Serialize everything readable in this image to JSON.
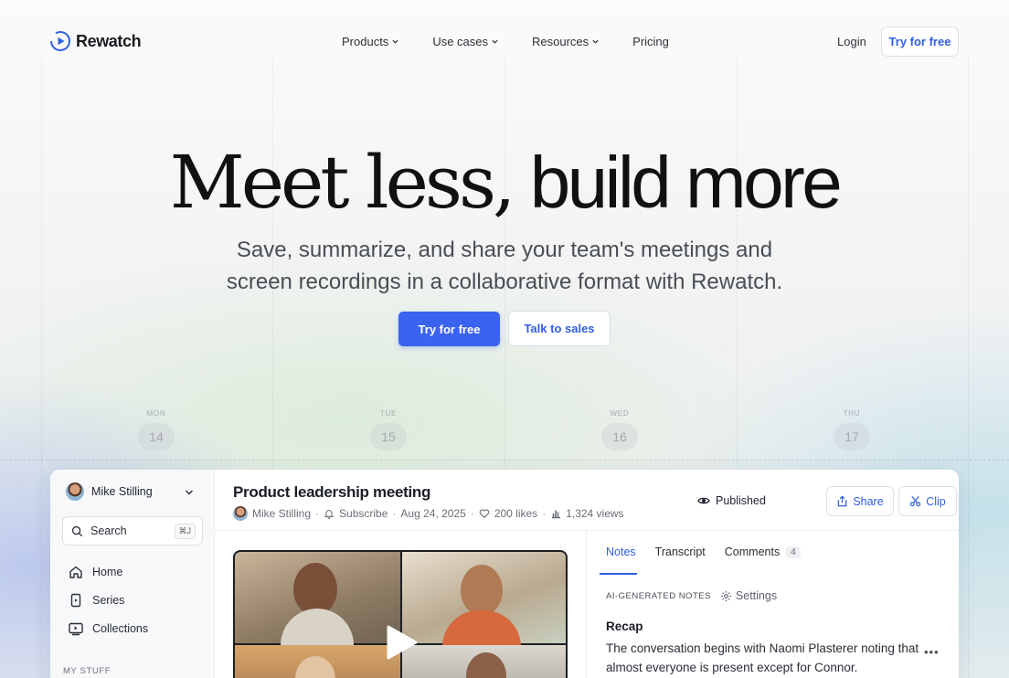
{
  "brand": {
    "name": "Rewatch"
  },
  "nav": {
    "links": [
      {
        "label": "Products",
        "dropdown": true
      },
      {
        "label": "Use cases",
        "dropdown": true
      },
      {
        "label": "Resources",
        "dropdown": true
      },
      {
        "label": "Pricing",
        "dropdown": false
      }
    ],
    "login": "Login",
    "try_free": "Try for free"
  },
  "hero": {
    "title_serif": "Meet less,",
    "title_sans": "build more",
    "subtitle_line1": "Save, summarize, and share your team's meetings and",
    "subtitle_line2": "screen recordings in a collaborative format with Rewatch.",
    "primary_cta": "Try for free",
    "secondary_cta": "Talk to sales"
  },
  "calendar": {
    "days": [
      {
        "name": "MON",
        "num": "14"
      },
      {
        "name": "TUE",
        "num": "15"
      },
      {
        "name": "WED",
        "num": "16"
      },
      {
        "name": "THU",
        "num": "17"
      }
    ]
  },
  "app": {
    "sidebar": {
      "user": "Mike Stilling",
      "search_label": "Search",
      "search_shortcut": "⌘J",
      "items": [
        {
          "label": "Home",
          "icon": "home-icon"
        },
        {
          "label": "Series",
          "icon": "series-icon"
        },
        {
          "label": "Collections",
          "icon": "collections-icon"
        }
      ],
      "section_label": "MY STUFF"
    },
    "meeting": {
      "title": "Product leadership meeting",
      "author": "Mike Stilling",
      "subscribe": "Subscribe",
      "date": "Aug 24, 2025",
      "likes": "200 likes",
      "views": "1,324 views",
      "status": "Published",
      "share": "Share",
      "clip": "Clip",
      "more": "•••"
    },
    "notes": {
      "tabs": [
        {
          "label": "Notes",
          "count": ""
        },
        {
          "label": "Transcript",
          "count": ""
        },
        {
          "label": "Comments",
          "count": "4"
        }
      ],
      "ai_label": "AI-GENERATED NOTES",
      "settings": "Settings",
      "recap_title": "Recap",
      "recap_text": "The conversation begins with Naomi Plasterer noting that almost everyone is present except for Connor.",
      "more": "•••"
    }
  },
  "colors": {
    "accent": "#3a63f0",
    "link": "#2f5fe0",
    "text": "#1f2430"
  }
}
